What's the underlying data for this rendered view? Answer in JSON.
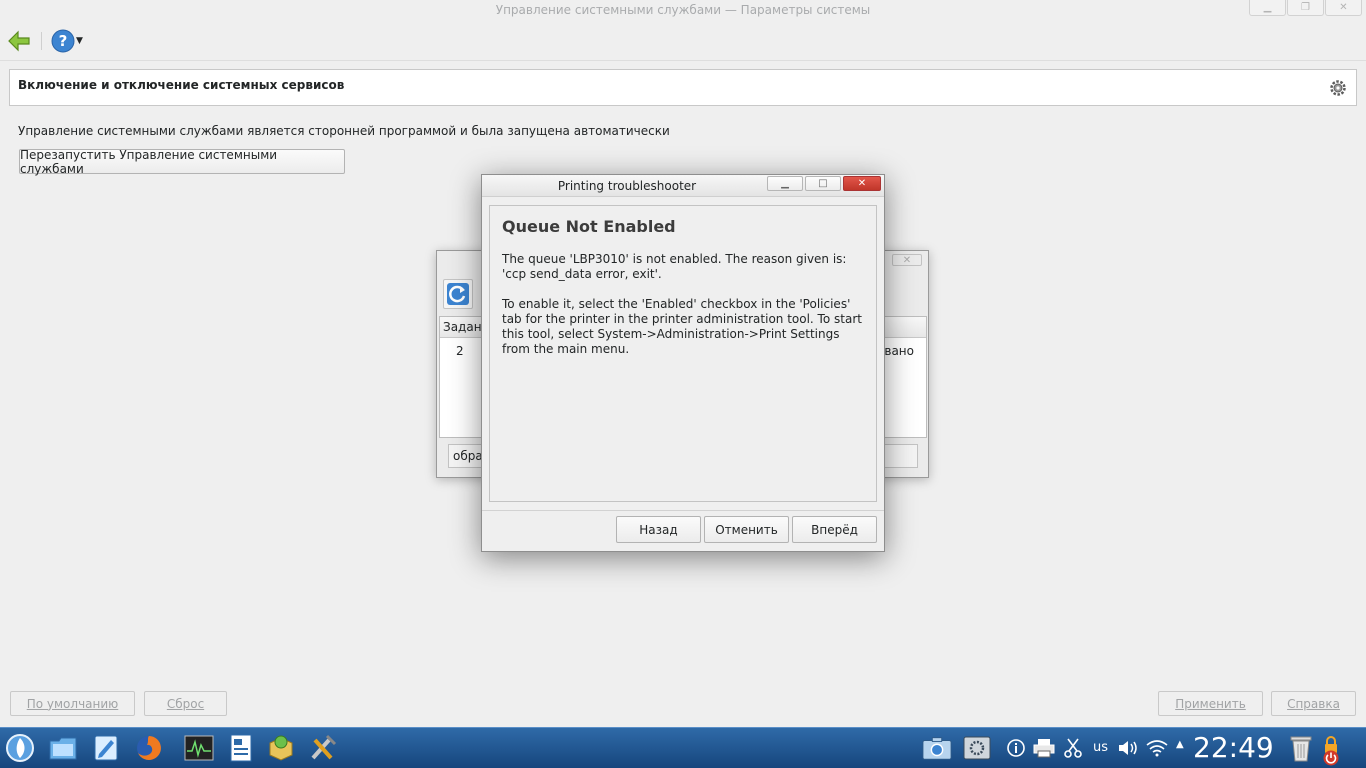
{
  "window": {
    "title": "Управление системными службами — Параметры системы"
  },
  "header": {
    "title": "Включение и отключение системных сервисов"
  },
  "main": {
    "info_text": "Управление системными службами является сторонней программой и была запущена автоматически",
    "restart_button": "Перезапустить Управление системными службами"
  },
  "footer": {
    "defaults_button": "По умолчанию",
    "reset_button": "Сброс",
    "apply_button": "Применить",
    "help_button": "Справка"
  },
  "jobs_window": {
    "column_header": "Задани",
    "row_number": "2",
    "row_status": "вано",
    "status_text": "обра"
  },
  "dialog": {
    "title": "Printing troubleshooter",
    "heading": "Queue Not Enabled",
    "paragraph1": "The queue 'LBP3010' is not enabled. The reason given is: 'ccp send_data error, exit'.",
    "paragraph2": "To enable it, select the 'Enabled' checkbox in the 'Policies' tab for the printer in the printer administration tool. To start this tool, select System->Administration->Print Settings from the main menu.",
    "back_button": "Назад",
    "cancel_button": "Отменить",
    "forward_button": "Вперёд"
  },
  "taskbar": {
    "keyboard_layout": "us",
    "clock": "22:49"
  },
  "colors": {
    "taskbar": "#1f5590",
    "close_button": "#d2463a",
    "accent": "#3c84d1"
  }
}
